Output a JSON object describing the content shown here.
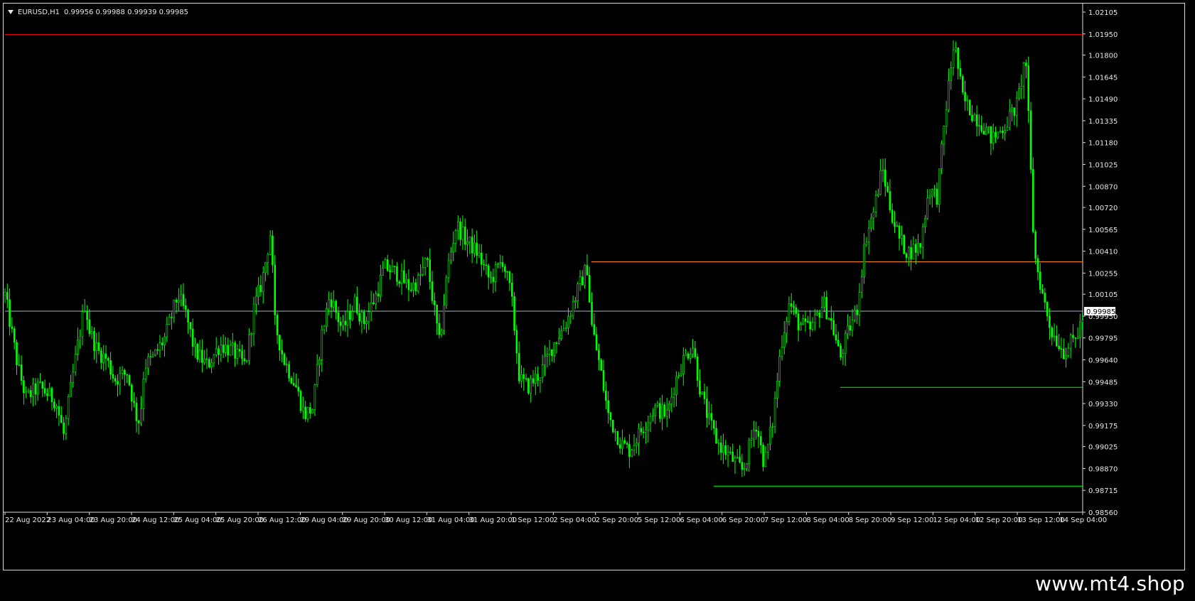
{
  "window": {
    "symbol_timeframe": "EURUSD,H1",
    "ohlc": "0.99956 0.99988 0.99939 0.99985"
  },
  "watermark": "www.mt4.shop",
  "colors": {
    "background": "#000000",
    "candle": "#00ff00",
    "grid": "#000000",
    "resistance_line": "#ff0000",
    "mid_line": "#ff8c00",
    "support_line": "#00ff00",
    "bid_line": "#a0b4c8",
    "axis_text": "#e6e6e6"
  },
  "chart_data": {
    "type": "candlestick",
    "symbol": "EURUSD",
    "timeframe": "H1",
    "y_ticks": [
      "1.02105",
      "1.01950",
      "1.01800",
      "1.01645",
      "1.01490",
      "1.01335",
      "1.01180",
      "1.01025",
      "1.00870",
      "1.00720",
      "1.00565",
      "1.00410",
      "1.00255",
      "1.00105",
      "0.99950",
      "0.99795",
      "0.99640",
      "0.99485",
      "0.99330",
      "0.99175",
      "0.99025",
      "0.98870",
      "0.98715",
      "0.98560"
    ],
    "ylim": [
      0.9856,
      1.02105
    ],
    "x_ticks": [
      "22 Aug 2022",
      "23 Aug 04:00",
      "23 Aug 20:00",
      "24 Aug 12:00",
      "25 Aug 04:00",
      "25 Aug 20:00",
      "26 Aug 12:00",
      "29 Aug 04:00",
      "29 Aug 20:00",
      "30 Aug 12:00",
      "31 Aug 04:00",
      "31 Aug 20:00",
      "1 Sep 12:00",
      "2 Sep 04:00",
      "2 Sep 20:00",
      "5 Sep 12:00",
      "6 Sep 04:00",
      "6 Sep 20:00",
      "7 Sep 12:00",
      "8 Sep 04:00",
      "8 Sep 20:00",
      "9 Sep 12:00",
      "12 Sep 04:00",
      "12 Sep 20:00",
      "13 Sep 12:00",
      "14 Sep 04:00"
    ],
    "current_price": "0.99985",
    "levels": [
      {
        "name": "resistance",
        "price": 1.01946,
        "from_index": 0
      },
      {
        "name": "mid",
        "price": 1.00335,
        "from_index": 13.9
      },
      {
        "name": "support-upper",
        "price": 0.99445,
        "from_index": 19.8
      },
      {
        "name": "support-lower",
        "price": 0.98745,
        "from_index": 16.8
      }
    ],
    "path": [
      [
        0.0,
        1.001
      ],
      [
        0.3,
        0.996
      ],
      [
        0.5,
        0.9937
      ],
      [
        0.8,
        0.9945
      ],
      [
        1.2,
        0.9935
      ],
      [
        1.4,
        0.991
      ],
      [
        1.5,
        0.9932
      ],
      [
        1.7,
        0.997
      ],
      [
        1.9,
        1.0005
      ],
      [
        2.0,
        0.9985
      ],
      [
        2.2,
        0.997
      ],
      [
        2.4,
        0.9965
      ],
      [
        2.6,
        0.995
      ],
      [
        2.9,
        0.9955
      ],
      [
        3.1,
        0.9925
      ],
      [
        3.2,
        0.992
      ],
      [
        3.3,
        0.996
      ],
      [
        3.5,
        0.9965
      ],
      [
        3.8,
        0.998
      ],
      [
        4.1,
        1.001
      ],
      [
        4.3,
        0.9995
      ],
      [
        4.5,
        0.997
      ],
      [
        4.8,
        0.996
      ],
      [
        5.1,
        0.9975
      ],
      [
        5.4,
        0.997
      ],
      [
        5.7,
        0.996
      ],
      [
        5.9,
        1.0
      ],
      [
        6.1,
        1.002
      ],
      [
        6.3,
        1.0055
      ],
      [
        6.4,
        0.999
      ],
      [
        6.6,
        0.9965
      ],
      [
        6.9,
        0.9945
      ],
      [
        7.1,
        0.9925
      ],
      [
        7.3,
        0.993
      ],
      [
        7.5,
        0.998
      ],
      [
        7.7,
        1.001
      ],
      [
        8.0,
        0.9985
      ],
      [
        8.3,
        1.0005
      ],
      [
        8.5,
        0.999
      ],
      [
        8.8,
        1.001
      ],
      [
        9.0,
        1.003
      ],
      [
        9.3,
        1.0025
      ],
      [
        9.6,
        1.0015
      ],
      [
        9.8,
        1.002
      ],
      [
        10.0,
        1.0035
      ],
      [
        10.3,
        0.9975
      ],
      [
        10.5,
        1.003
      ],
      [
        10.7,
        1.006
      ],
      [
        10.9,
        1.005
      ],
      [
        11.2,
        1.004
      ],
      [
        11.5,
        1.002
      ],
      [
        11.8,
        1.0035
      ],
      [
        12.0,
        1.001
      ],
      [
        12.2,
        0.995
      ],
      [
        12.4,
        0.9945
      ],
      [
        12.7,
        0.9955
      ],
      [
        13.0,
        0.9975
      ],
      [
        13.3,
        0.999
      ],
      [
        13.6,
        1.0015
      ],
      [
        13.8,
        1.003
      ],
      [
        13.9,
        0.999
      ],
      [
        14.1,
        0.996
      ],
      [
        14.3,
        0.9925
      ],
      [
        14.6,
        0.9905
      ],
      [
        14.8,
        0.99
      ],
      [
        15.1,
        0.9915
      ],
      [
        15.4,
        0.993
      ],
      [
        15.7,
        0.9925
      ],
      [
        15.9,
        0.995
      ],
      [
        16.1,
        0.9965
      ],
      [
        16.3,
        0.9975
      ],
      [
        16.5,
        0.994
      ],
      [
        16.7,
        0.992
      ],
      [
        16.9,
        0.9905
      ],
      [
        17.2,
        0.9895
      ],
      [
        17.5,
        0.9885
      ],
      [
        17.8,
        0.992
      ],
      [
        18.0,
        0.989
      ],
      [
        18.2,
        0.992
      ],
      [
        18.4,
        0.9975
      ],
      [
        18.6,
        1.0005
      ],
      [
        18.8,
        0.999
      ],
      [
        19.1,
        0.9985
      ],
      [
        19.4,
        1.0005
      ],
      [
        19.6,
        0.999
      ],
      [
        19.8,
        0.9965
      ],
      [
        20.0,
        0.9985
      ],
      [
        20.2,
        1.0
      ],
      [
        20.4,
        1.005
      ],
      [
        20.6,
        1.007
      ],
      [
        20.8,
        1.01
      ],
      [
        21.0,
        1.007
      ],
      [
        21.2,
        1.005
      ],
      [
        21.4,
        1.004
      ],
      [
        21.7,
        1.0045
      ],
      [
        21.9,
        1.0085
      ],
      [
        22.1,
        1.008
      ],
      [
        22.3,
        1.014
      ],
      [
        22.5,
        1.019
      ],
      [
        22.7,
        1.015
      ],
      [
        22.9,
        1.014
      ],
      [
        23.2,
        1.013
      ],
      [
        23.4,
        1.012
      ],
      [
        23.7,
        1.013
      ],
      [
        24.0,
        1.0145
      ],
      [
        24.2,
        1.018
      ],
      [
        24.4,
        1.004
      ],
      [
        24.6,
        1.001
      ],
      [
        24.8,
        0.9985
      ],
      [
        25.1,
        0.997
      ],
      [
        25.4,
        0.998
      ],
      [
        25.6,
        0.99985
      ]
    ]
  }
}
